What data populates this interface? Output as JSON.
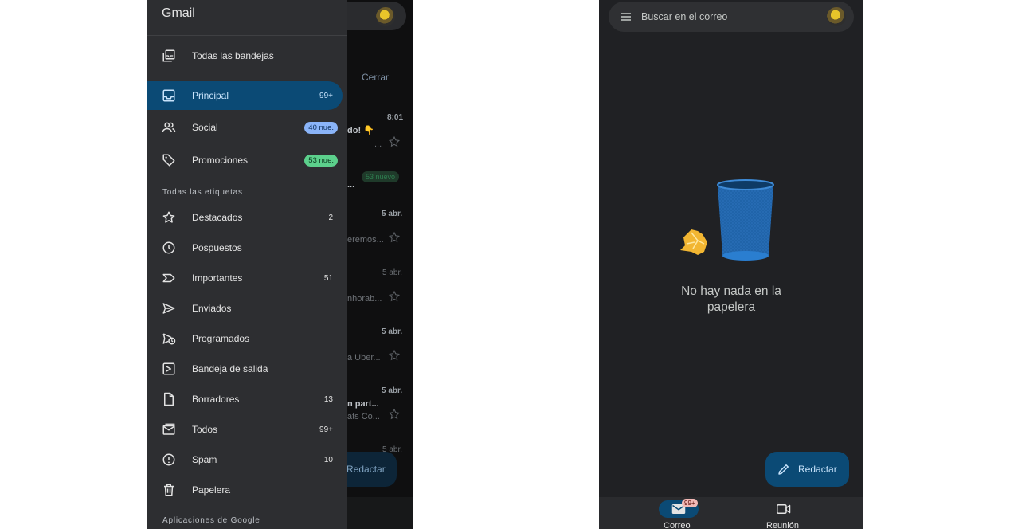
{
  "left_screen": {
    "background_inbox": {
      "close_label": "Cerrar",
      "rows": [
        {
          "date": "8:01",
          "snippet": "do! 👇",
          "snippet2": "..."
        },
        {
          "badge": "53 nuevo",
          "snippet": "..."
        },
        {
          "date": "5 abr.",
          "snippet": "eremos..."
        },
        {
          "date": "5 abr.",
          "snippet": "nhorab..."
        },
        {
          "date": "5 abr.",
          "snippet": "a Uber..."
        },
        {
          "date": "5 abr.",
          "snippet": "n part...",
          "snippet2": "ats Co..."
        },
        {
          "date": "5 abr."
        }
      ],
      "compose_label": "Redactar"
    },
    "drawer": {
      "app_title": "Gmail",
      "all_inboxes": {
        "label": "Todas las bandejas",
        "icon": "all-inboxes-icon"
      },
      "categories": [
        {
          "label": "Principal",
          "count": "99+",
          "icon": "inbox-icon",
          "selected": true
        },
        {
          "label": "Social",
          "pill": "40 nue.",
          "pill_color": "#8ab4f8",
          "icon": "people-icon"
        },
        {
          "label": "Promociones",
          "pill": "53 nue.",
          "pill_color": "#5cd08c",
          "icon": "tag-icon"
        }
      ],
      "all_labels_heading": "Todas las etiquetas",
      "labels": [
        {
          "label": "Destacados",
          "count": "2",
          "icon": "star-icon"
        },
        {
          "label": "Pospuestos",
          "count": "",
          "icon": "clock-icon"
        },
        {
          "label": "Importantes",
          "count": "51",
          "icon": "important-icon"
        },
        {
          "label": "Enviados",
          "count": "",
          "icon": "send-icon"
        },
        {
          "label": "Programados",
          "count": "",
          "icon": "scheduled-send-icon"
        },
        {
          "label": "Bandeja de salida",
          "count": "",
          "icon": "outbox-icon"
        },
        {
          "label": "Borradores",
          "count": "13",
          "icon": "draft-icon"
        },
        {
          "label": "Todos",
          "count": "99+",
          "icon": "all-mail-icon"
        },
        {
          "label": "Spam",
          "count": "10",
          "icon": "spam-icon"
        },
        {
          "label": "Papelera",
          "count": "",
          "icon": "trash-icon"
        }
      ],
      "google_apps_heading": "Aplicaciones de Google"
    }
  },
  "right_screen": {
    "search": {
      "placeholder": "Buscar en el correo"
    },
    "empty_state": {
      "message": "No hay nada en la papelera"
    },
    "compose": {
      "label": "Redactar",
      "icon": "pencil-icon"
    },
    "bottom_nav": {
      "mail": {
        "label": "Correo",
        "badge": "99+",
        "icon": "mail-icon"
      },
      "meet": {
        "label": "Reunión",
        "icon": "video-icon"
      }
    }
  },
  "colors": {
    "selected_background": "#0b4a75",
    "drawer_background": "#2d2e31",
    "app_background": "#202124",
    "social_pill": "#8ab4f8",
    "promotions_pill": "#5cd08c"
  }
}
